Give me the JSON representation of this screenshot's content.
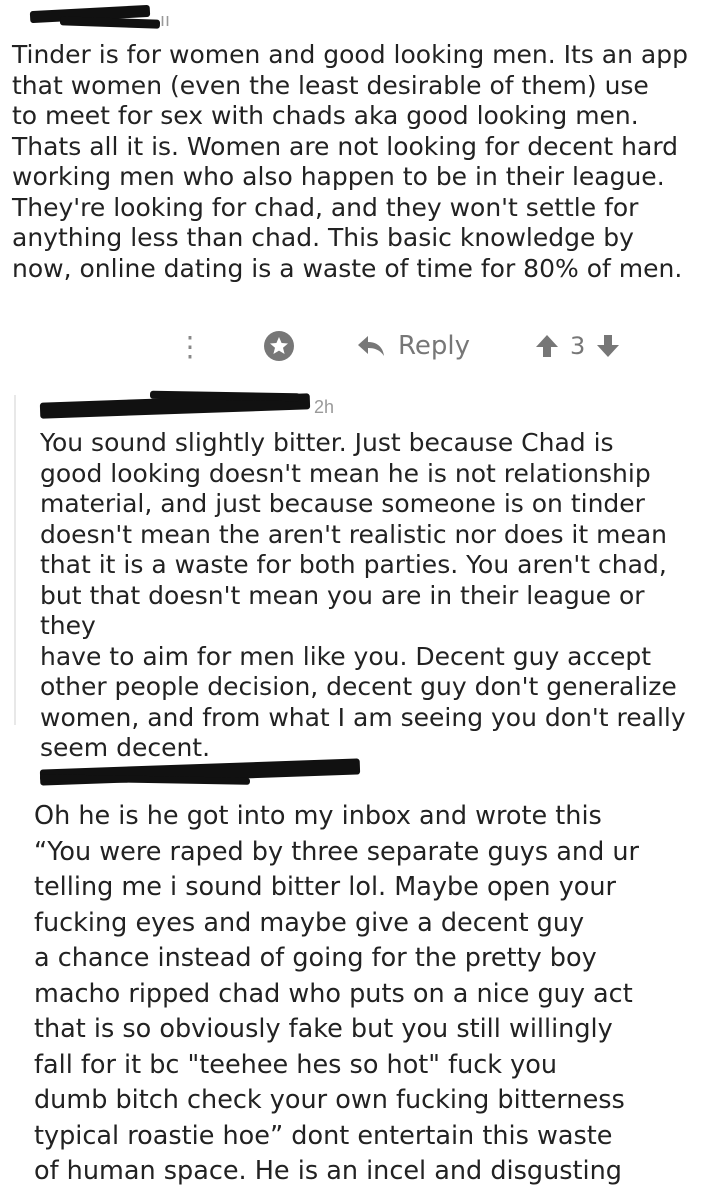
{
  "comment1": {
    "meta_suffix": "ıı",
    "text": "Tinder is for women and good looking men. Its an app\nthat women (even the least desirable of them) use\nto meet for sex with chads aka good looking men.\nThats all it is. Women are not looking for decent hard\nworking men who also happen to be in their league.\nThey're looking for chad, and they won't settle for\nanything less than chad. This basic knowledge by\nnow, online dating is a waste of time for 80% of men.",
    "actions": {
      "more_icon": "more-vertical-icon",
      "award_icon": "award-icon",
      "reply_icon": "reply-arrow-icon",
      "reply_label": "Reply",
      "upvote_icon": "arrow-up-icon",
      "score": "3",
      "downvote_icon": "arrow-down-icon"
    }
  },
  "comment2": {
    "time": "2h",
    "text": "You sound slightly bitter. Just because Chad is\ngood looking doesn't mean he is not relationship\nmaterial, and just because someone is on tinder\ndoesn't mean the aren't realistic nor does it mean\nthat it is a waste for both parties. You aren't chad,\nbut that doesn't mean you are in their league or they\nhave to aim for men like you. Decent guy accept\nother people decision, decent guy don't generalize\nwomen, and from what I am seeing you don't really\nseem decent."
  },
  "comment3": {
    "text": "Oh he is he got into my inbox and wrote this\n“You were raped by three separate guys and ur\ntelling me i sound bitter lol. Maybe open your\nfucking eyes and maybe give a decent guy\na chance instead of going for the pretty boy\nmacho ripped chad who puts on a nice guy act\nthat is so obviously fake but you still willingly\nfall for it bc \"teehee hes so hot\" fuck you\ndumb bitch check your own fucking bitterness\ntypical roastie hoe” dont entertain this waste\nof human space. He is an incel and disgusting"
  },
  "colors": {
    "text": "#222222",
    "muted": "#777777",
    "redaction": "#111111",
    "background": "#ffffff"
  }
}
